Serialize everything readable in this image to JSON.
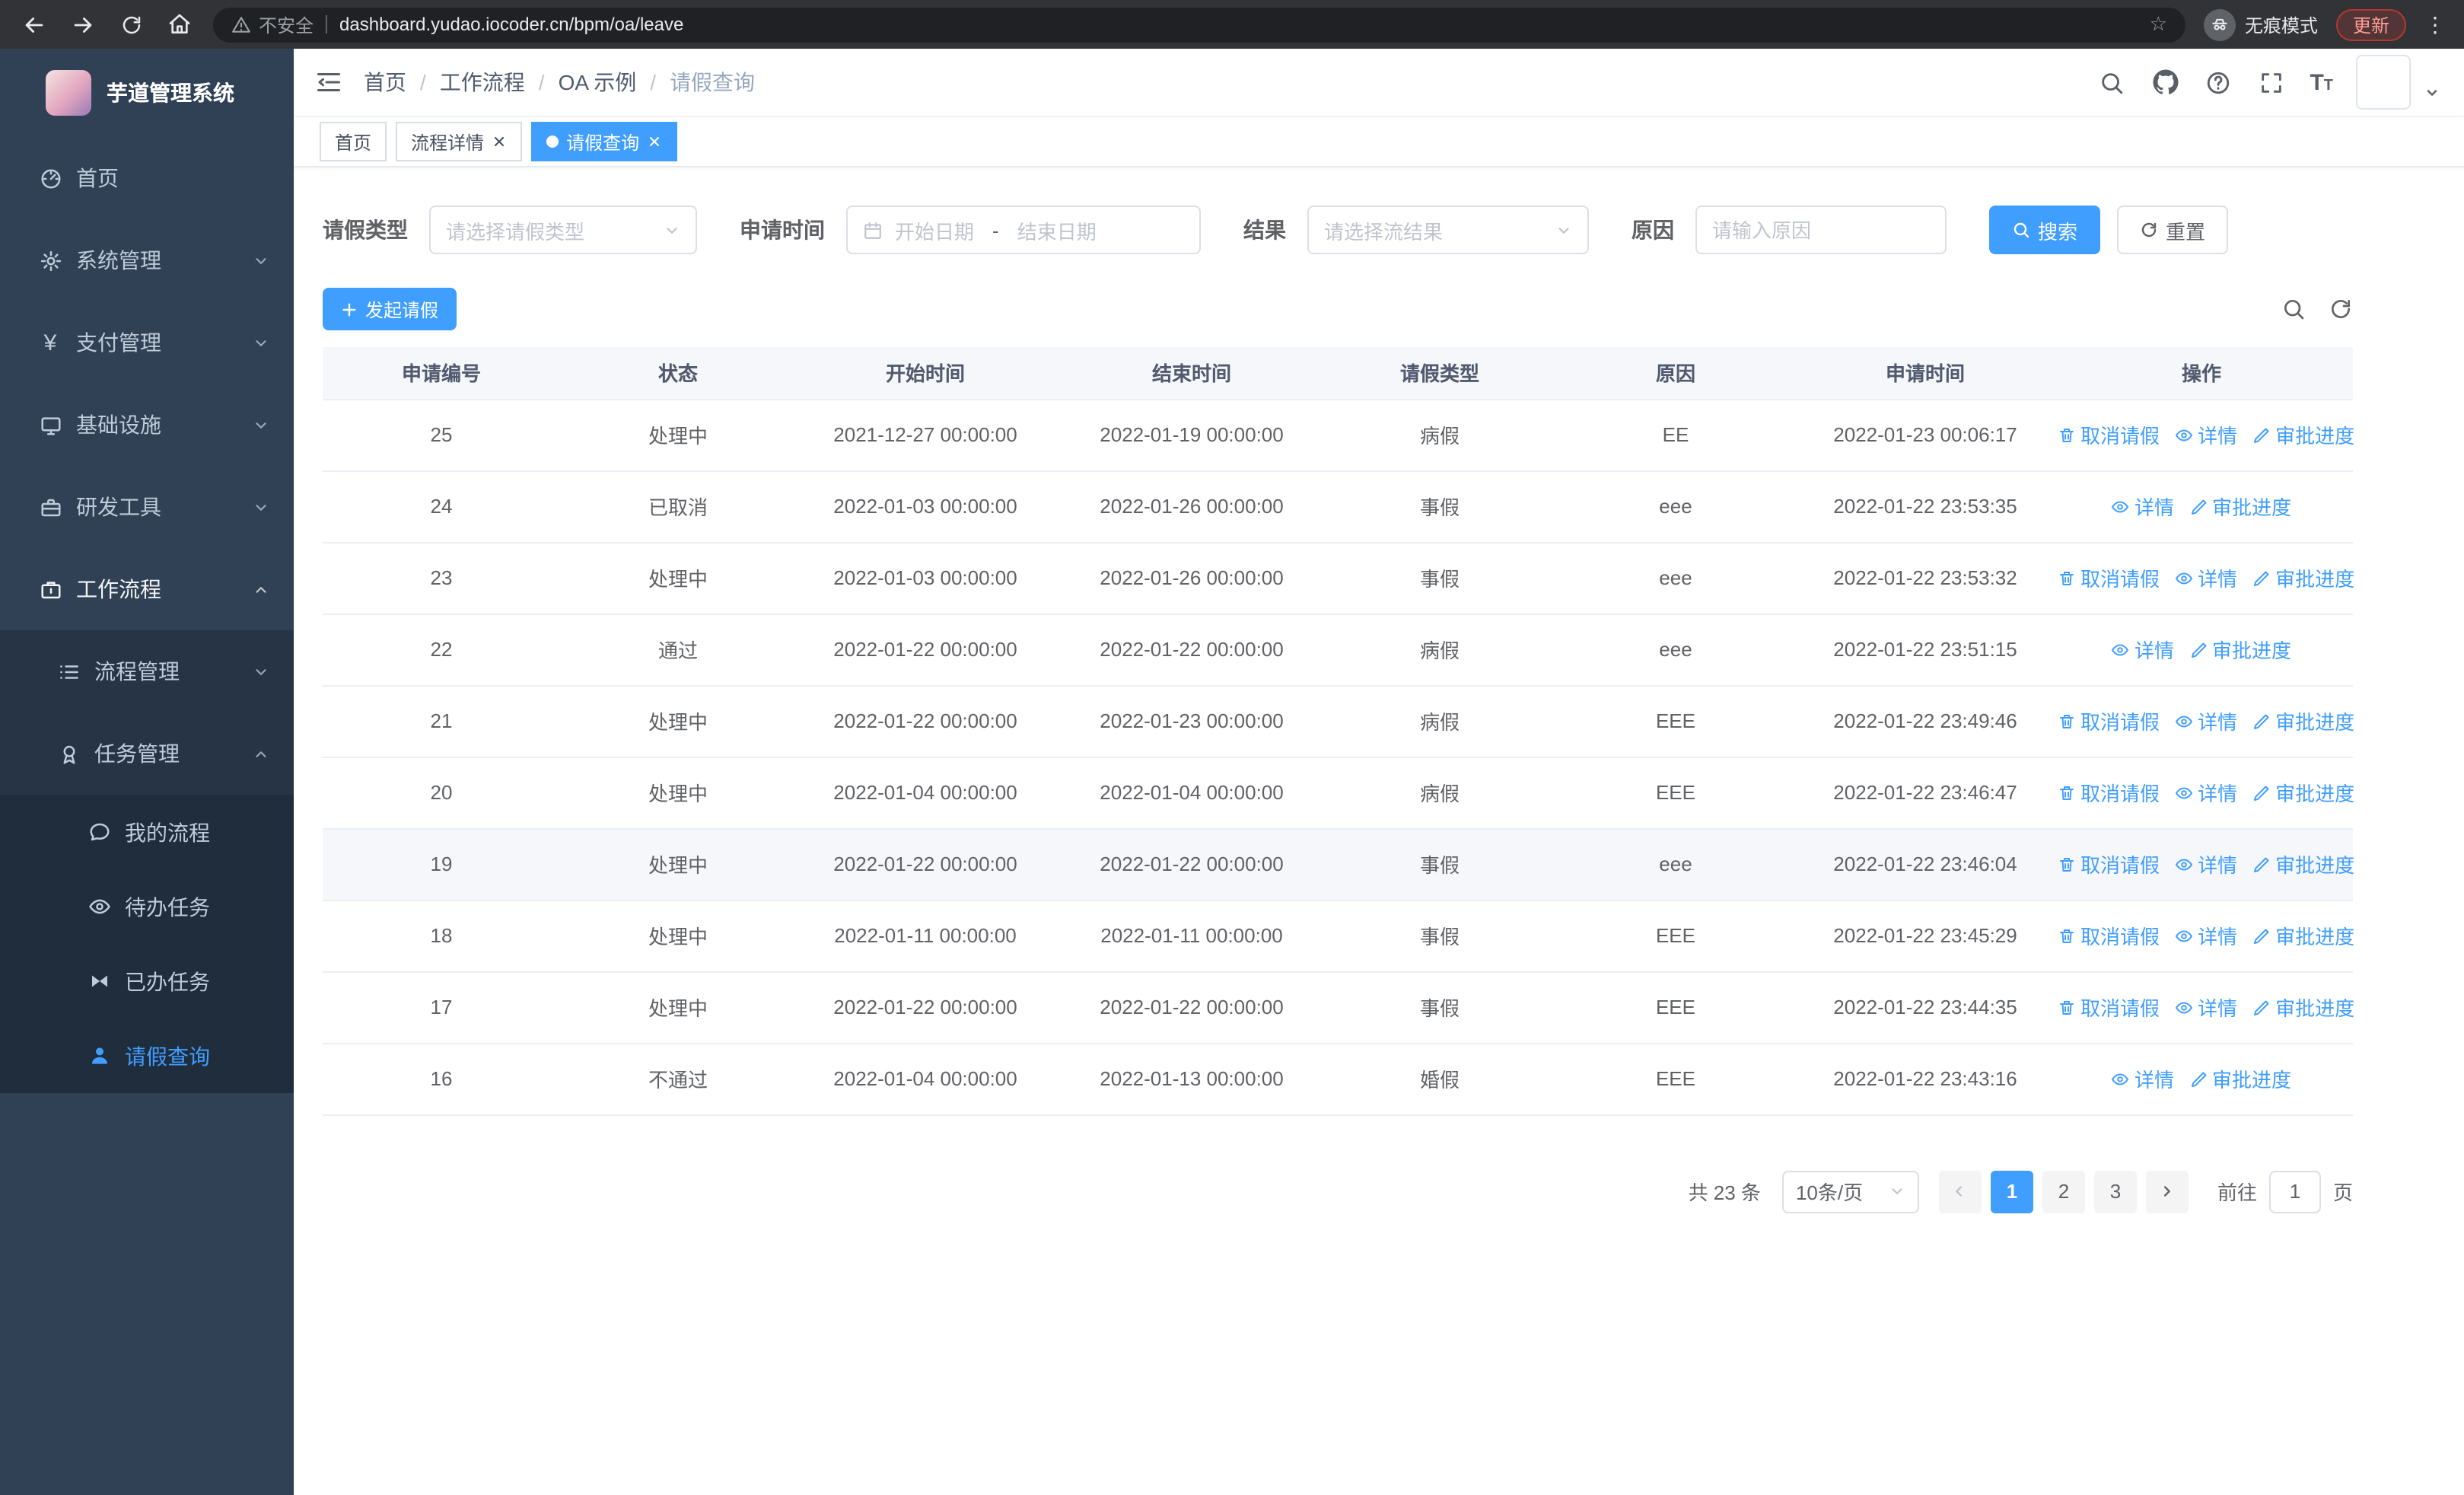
{
  "browser": {
    "security_warning": "不安全",
    "url": "dashboard.yudao.iocoder.cn/bpm/oa/leave",
    "incognito_label": "无痕模式",
    "update_label": "更新"
  },
  "sidebar": {
    "logo_title": "芋道管理系统",
    "menu": [
      {
        "label": "首页",
        "icon": "dashboard-icon"
      },
      {
        "label": "系统管理",
        "icon": "gear-icon"
      },
      {
        "label": "支付管理",
        "icon": "yen-icon"
      },
      {
        "label": "基础设施",
        "icon": "monitor-icon"
      },
      {
        "label": "研发工具",
        "icon": "toolbox-icon"
      },
      {
        "label": "工作流程",
        "icon": "briefcase-icon"
      }
    ],
    "submenu": [
      {
        "label": "流程管理",
        "icon": "list-icon"
      },
      {
        "label": "任务管理",
        "icon": "medal-icon"
      }
    ],
    "task_items": [
      {
        "label": "我的流程",
        "icon": "chat-icon"
      },
      {
        "label": "待办任务",
        "icon": "eye-icon"
      },
      {
        "label": "已办任务",
        "icon": "bowtie-icon"
      },
      {
        "label": "请假查询",
        "icon": "user-icon"
      }
    ]
  },
  "header": {
    "breadcrumb": [
      "首页",
      "工作流程",
      "OA 示例",
      "请假查询"
    ],
    "breadcrumb_separator": "/"
  },
  "tabs": [
    {
      "label": "首页"
    },
    {
      "label": "流程详情"
    },
    {
      "label": "请假查询"
    }
  ],
  "filters": {
    "leave_type_label": "请假类型",
    "leave_type_placeholder": "请选择请假类型",
    "apply_time_label": "申请时间",
    "start_date_placeholder": "开始日期",
    "range_separator": "-",
    "end_date_placeholder": "结束日期",
    "result_label": "结果",
    "result_placeholder": "请选择流结果",
    "reason_label": "原因",
    "reason_placeholder": "请输入原因",
    "search_button": "搜索",
    "reset_button": "重置"
  },
  "toolbar": {
    "create_button": "发起请假"
  },
  "table": {
    "columns": [
      "申请编号",
      "状态",
      "开始时间",
      "结束时间",
      "请假类型",
      "原因",
      "申请时间",
      "操作"
    ],
    "action_labels": {
      "cancel": "取消请假",
      "detail": "详情",
      "progress": "审批进度"
    },
    "rows": [
      {
        "no": "25",
        "status": "处理中",
        "start": "2021-12-27 00:00:00",
        "end": "2022-01-19 00:00:00",
        "type": "病假",
        "reason": "EE",
        "apply_time": "2022-01-23 00:06:17",
        "actions": [
          "cancel",
          "detail",
          "progress"
        ],
        "highlighted": false
      },
      {
        "no": "24",
        "status": "已取消",
        "start": "2022-01-03 00:00:00",
        "end": "2022-01-26 00:00:00",
        "type": "事假",
        "reason": "eee",
        "apply_time": "2022-01-22 23:53:35",
        "actions": [
          "detail",
          "progress"
        ],
        "highlighted": false
      },
      {
        "no": "23",
        "status": "处理中",
        "start": "2022-01-03 00:00:00",
        "end": "2022-01-26 00:00:00",
        "type": "事假",
        "reason": "eee",
        "apply_time": "2022-01-22 23:53:32",
        "actions": [
          "cancel",
          "detail",
          "progress"
        ],
        "highlighted": false
      },
      {
        "no": "22",
        "status": "通过",
        "start": "2022-01-22 00:00:00",
        "end": "2022-01-22 00:00:00",
        "type": "病假",
        "reason": "eee",
        "apply_time": "2022-01-22 23:51:15",
        "actions": [
          "detail",
          "progress"
        ],
        "highlighted": false
      },
      {
        "no": "21",
        "status": "处理中",
        "start": "2022-01-22 00:00:00",
        "end": "2022-01-23 00:00:00",
        "type": "病假",
        "reason": "EEE",
        "apply_time": "2022-01-22 23:49:46",
        "actions": [
          "cancel",
          "detail",
          "progress"
        ],
        "highlighted": false
      },
      {
        "no": "20",
        "status": "处理中",
        "start": "2022-01-04 00:00:00",
        "end": "2022-01-04 00:00:00",
        "type": "病假",
        "reason": "EEE",
        "apply_time": "2022-01-22 23:46:47",
        "actions": [
          "cancel",
          "detail",
          "progress"
        ],
        "highlighted": false
      },
      {
        "no": "19",
        "status": "处理中",
        "start": "2022-01-22 00:00:00",
        "end": "2022-01-22 00:00:00",
        "type": "事假",
        "reason": "eee",
        "apply_time": "2022-01-22 23:46:04",
        "actions": [
          "cancel",
          "detail",
          "progress"
        ],
        "highlighted": true
      },
      {
        "no": "18",
        "status": "处理中",
        "start": "2022-01-11 00:00:00",
        "end": "2022-01-11 00:00:00",
        "type": "事假",
        "reason": "EEE",
        "apply_time": "2022-01-22 23:45:29",
        "actions": [
          "cancel",
          "detail",
          "progress"
        ],
        "highlighted": false
      },
      {
        "no": "17",
        "status": "处理中",
        "start": "2022-01-22 00:00:00",
        "end": "2022-01-22 00:00:00",
        "type": "事假",
        "reason": "EEE",
        "apply_time": "2022-01-22 23:44:35",
        "actions": [
          "cancel",
          "detail",
          "progress"
        ],
        "highlighted": false
      },
      {
        "no": "16",
        "status": "不通过",
        "start": "2022-01-04 00:00:00",
        "end": "2022-01-13 00:00:00",
        "type": "婚假",
        "reason": "EEE",
        "apply_time": "2022-01-22 23:43:16",
        "actions": [
          "detail",
          "progress"
        ],
        "highlighted": false
      }
    ]
  },
  "pagination": {
    "total_text": "共 23 条",
    "page_size": "10条/页",
    "pages": [
      "1",
      "2",
      "3"
    ],
    "active_page": "1",
    "goto_label": "前往",
    "goto_value": "1",
    "goto_unit": "页"
  },
  "colors": {
    "accent": "#409eff",
    "sidebar_bg": "#304156",
    "sidebar_sub_bg": "#1f2d3d"
  }
}
